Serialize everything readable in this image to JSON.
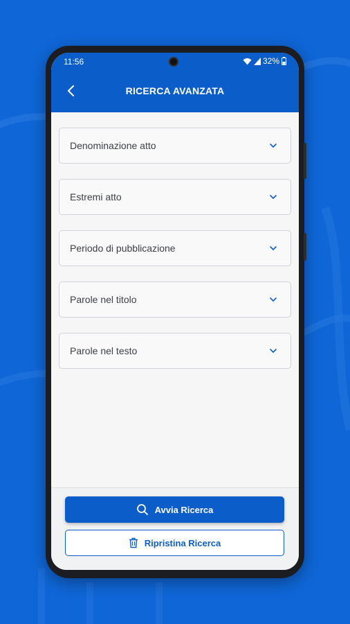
{
  "colors": {
    "brand": "#0b5ec9",
    "background": "#0f66d6",
    "field_border": "#cfd2d6"
  },
  "status": {
    "time": "11:56",
    "battery": "32%"
  },
  "appbar": {
    "title": "RICERCA AVANZATA",
    "back_icon": "chevron-left-icon"
  },
  "filters": [
    {
      "label": "Denominazione atto"
    },
    {
      "label": "Estremi atto"
    },
    {
      "label": "Periodo di pubblicazione"
    },
    {
      "label": "Parole nel titolo"
    },
    {
      "label": "Parole nel testo"
    }
  ],
  "actions": {
    "search_label": "Avvia Ricerca",
    "search_icon": "search-icon",
    "reset_label": "Ripristina Ricerca",
    "reset_icon": "trash-icon"
  }
}
